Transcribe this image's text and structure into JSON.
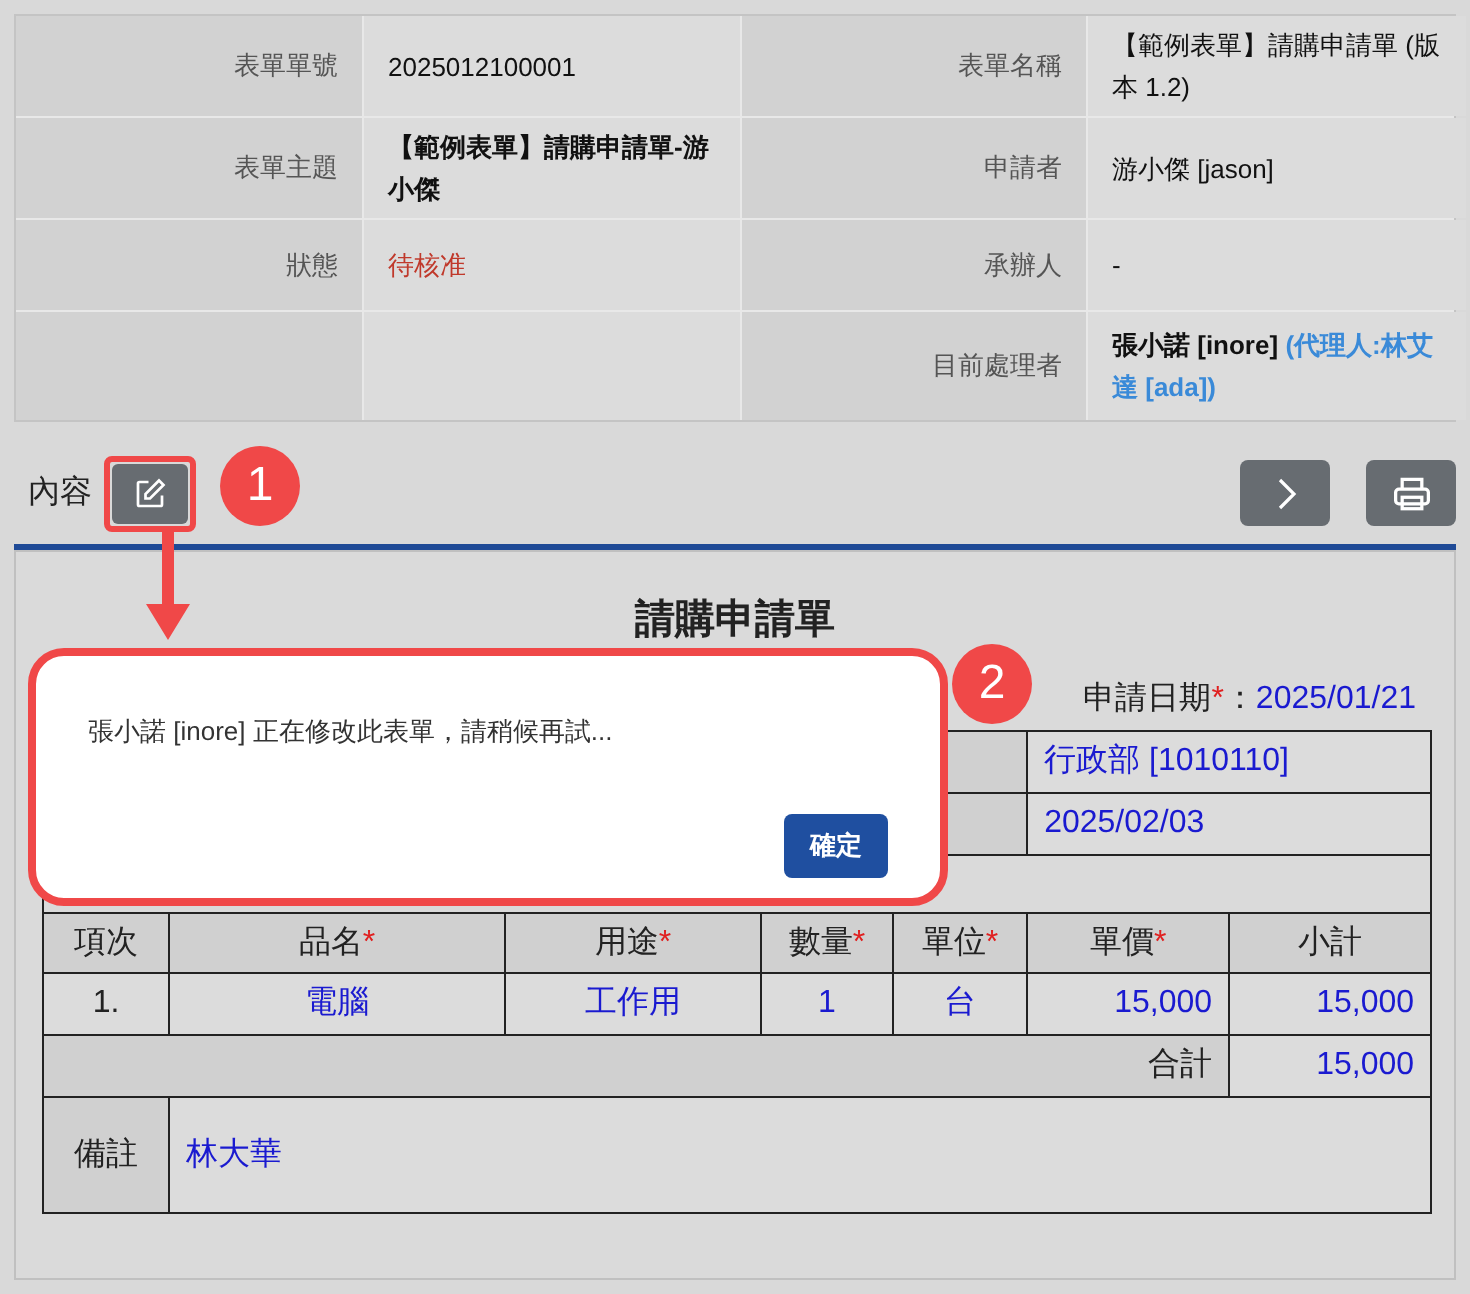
{
  "info": [
    {
      "left": {
        "label": "表單單號",
        "value": "2025012100001",
        "kind": "plain"
      },
      "right": {
        "label": "表單名稱",
        "value": "【範例表單】請購申請單 (版本 1.2)",
        "kind": "plain"
      }
    },
    {
      "left": {
        "label": "表單主題",
        "value": "【範例表單】請購申請單-游小傑",
        "kind": "bold"
      },
      "right": {
        "label": "申請者",
        "value": "游小傑 [jason]",
        "kind": "plain"
      }
    },
    {
      "left": {
        "label": "狀態",
        "value": "待核准",
        "kind": "status"
      },
      "right": {
        "label": "承辦人",
        "value": "-",
        "kind": "plain"
      }
    },
    {
      "right": {
        "label": "目前處理者",
        "value": "張小諾 [inore]",
        "note": "(代理人:林艾達 [ada])",
        "kind": "handler"
      }
    }
  ],
  "section_title": "內容",
  "annotations": [
    {
      "label": "1"
    },
    {
      "label": "2"
    }
  ],
  "form": {
    "title": "請購申請單",
    "required_mark": "*",
    "date_label": "申請日期",
    "date_required": true,
    "date_separator": "：",
    "date_value": "2025/01/21",
    "upper_rows": [
      {
        "value": "行政部 [1010110]"
      },
      {
        "value": "2025/02/03"
      }
    ],
    "columns": [
      {
        "label": "項次",
        "required": false
      },
      {
        "label": "品名",
        "required": true
      },
      {
        "label": "用途",
        "required": true
      },
      {
        "label": "數量",
        "required": true
      },
      {
        "label": "單位",
        "required": true
      },
      {
        "label": "單價",
        "required": true
      },
      {
        "label": "小計",
        "required": false
      }
    ],
    "items": [
      {
        "no": "1.",
        "name": "電腦",
        "purpose": "工作用",
        "qty": "1",
        "unit": "台",
        "price": "15,000",
        "subtotal": "15,000"
      }
    ],
    "total_label": "合計",
    "total_value": "15,000",
    "remarks_label": "備註",
    "remarks_value": "林大華"
  },
  "dialog": {
    "message": "張小諾 [inore] 正在修改此表單，請稍候再試...",
    "button": "確定"
  }
}
